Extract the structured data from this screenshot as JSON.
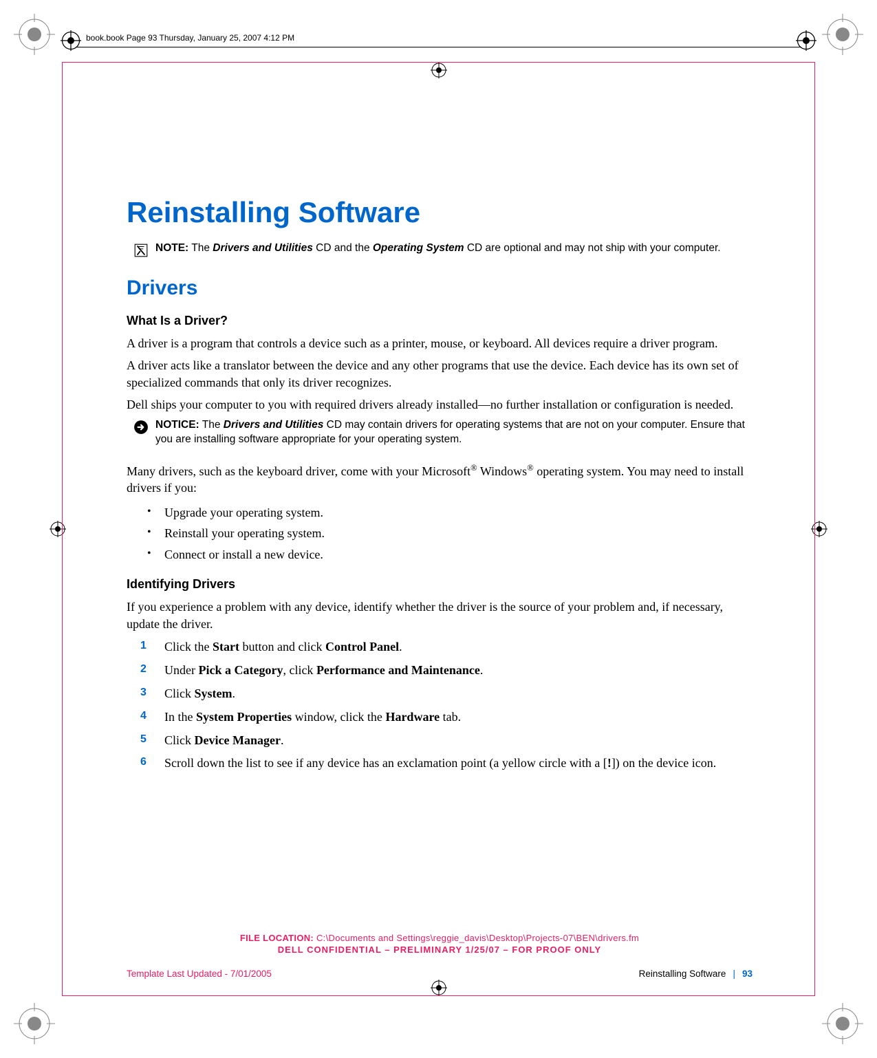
{
  "header": {
    "book_info": "book.book  Page 93  Thursday, January 25, 2007  4:12 PM"
  },
  "title": "Reinstalling Software",
  "note1": {
    "label": "NOTE:",
    "text1": " The ",
    "em1": "Drivers and Utilities",
    "text2": " CD and the ",
    "em2": "Operating System",
    "text3": " CD are optional and may not ship with your computer."
  },
  "section1": {
    "heading": "Drivers",
    "sub1": {
      "heading": "What Is a Driver?",
      "p1": "A driver is a program that controls a device such as a printer, mouse, or keyboard. All devices require a driver program.",
      "p2": "A driver acts like a translator between the device and any other programs that use the device. Each device has its own set of specialized commands that only its driver recognizes.",
      "p3": "Dell ships your computer to you with required drivers already installed—no further installation or configuration is needed."
    },
    "notice": {
      "label": "NOTICE:",
      "text1": " The ",
      "em1": "Drivers and Utilities",
      "text2": " CD may contain drivers for operating systems that are not on your computer. Ensure that you are installing software appropriate for your operating system."
    },
    "p4a": "Many drivers, such as the keyboard driver, come with your Microsoft",
    "p4b": " Windows",
    "p4c": " operating system. You may need to install drivers if you:",
    "bullets": [
      "Upgrade your operating system.",
      "Reinstall your operating system.",
      "Connect or install a new device."
    ],
    "sub2": {
      "heading": "Identifying Drivers",
      "p1": "If you experience a problem with any device, identify whether the driver is the source of your problem and, if necessary, update the driver.",
      "steps": [
        {
          "n": "1",
          "a": "Click the ",
          "b": "Start",
          "c": " button and click ",
          "d": "Control Panel",
          "e": "."
        },
        {
          "n": "2",
          "a": "Under ",
          "b": "Pick a Category",
          "c": ", click ",
          "d": "Performance and Maintenance",
          "e": "."
        },
        {
          "n": "3",
          "a": "Click ",
          "b": "System",
          "c": ".",
          "d": "",
          "e": ""
        },
        {
          "n": "4",
          "a": "In the ",
          "b": "System Properties",
          "c": " window, click the ",
          "d": "Hardware",
          "e": " tab."
        },
        {
          "n": "5",
          "a": "Click ",
          "b": "Device Manager",
          "c": ".",
          "d": "",
          "e": ""
        },
        {
          "n": "6",
          "a": "Scroll down the list to see if any device has an exclamation point (a yellow circle with a [",
          "b": "!",
          "c": "]) on the device icon.",
          "d": "",
          "e": ""
        }
      ]
    }
  },
  "footer": {
    "file_label": "FILE LOCATION:",
    "file_path": "  C:\\Documents and Settings\\reggie_davis\\Desktop\\Projects-07\\BEN\\drivers.fm",
    "confidential": "DELL CONFIDENTIAL – PRELIMINARY 1/25/07 – FOR PROOF ONLY",
    "template": "Template Last Updated - 7/01/2005",
    "section": "Reinstalling Software",
    "page": "93"
  }
}
